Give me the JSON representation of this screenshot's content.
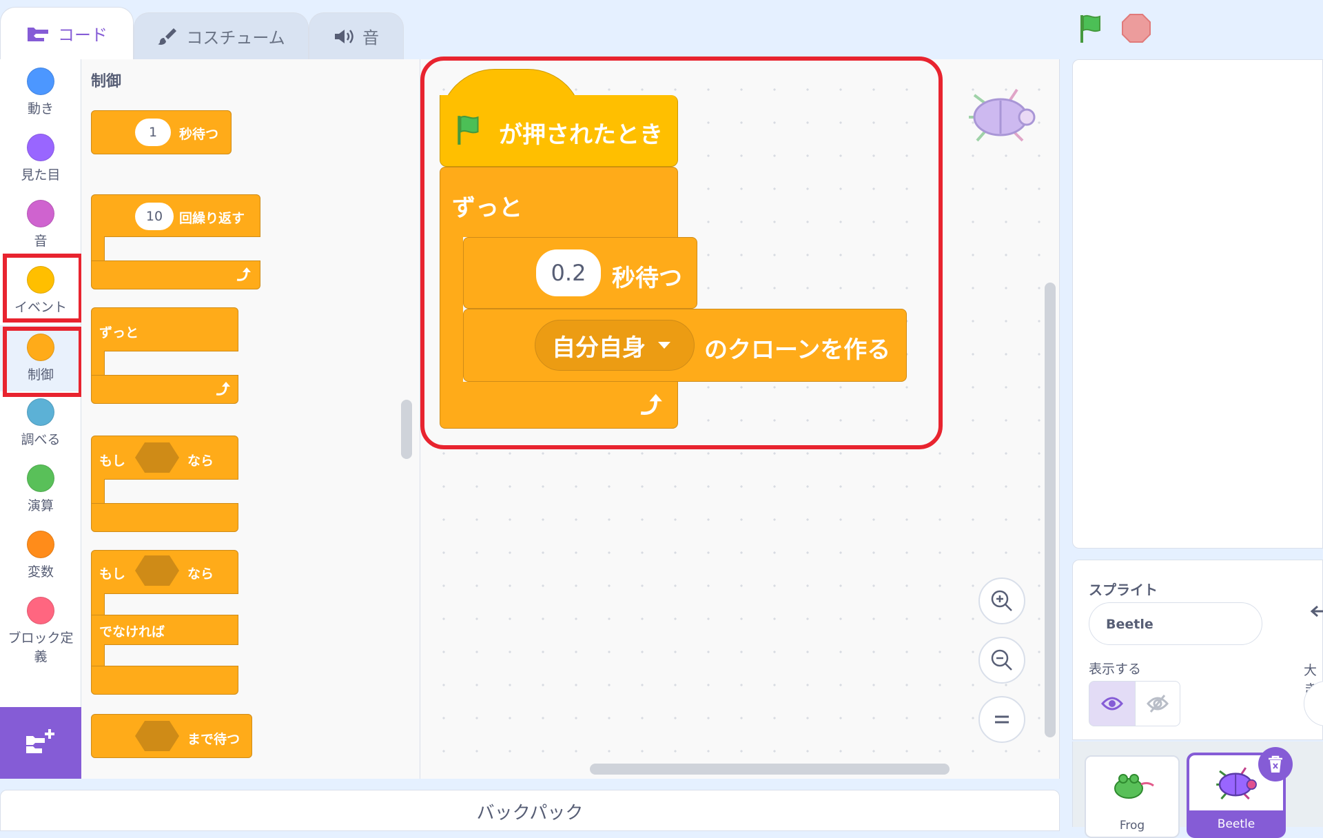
{
  "tabs": [
    {
      "label": "コード",
      "icon": "code-icon"
    },
    {
      "label": "コスチューム",
      "icon": "brush-icon"
    },
    {
      "label": "音",
      "icon": "speaker-icon"
    }
  ],
  "controls": {
    "green_flag": "green-flag-icon",
    "stop": "stop-icon"
  },
  "categories": [
    {
      "label": "動き",
      "color": "#4c97ff"
    },
    {
      "label": "見た目",
      "color": "#9966ff"
    },
    {
      "label": "音",
      "color": "#cf63cf"
    },
    {
      "label": "イベント",
      "color": "#ffbf00"
    },
    {
      "label": "制御",
      "color": "#ffab19"
    },
    {
      "label": "調べる",
      "color": "#5cb1d6"
    },
    {
      "label": "演算",
      "color": "#59c059"
    },
    {
      "label": "変数",
      "color": "#ff8c1a"
    },
    {
      "label": "ブロック定",
      "label2": "義",
      "color": "#ff6680"
    }
  ],
  "palette": {
    "title": "制御",
    "wait": {
      "value": "1",
      "label": "秒待つ"
    },
    "repeat": {
      "value": "10",
      "label": "回繰り返す"
    },
    "forever": {
      "label": "ずっと"
    },
    "if_then": {
      "if": "もし",
      "then": "なら"
    },
    "if_else": {
      "if": "もし",
      "then": "なら",
      "else": "でなければ"
    },
    "wait_until": {
      "label": "まで待つ"
    }
  },
  "script": {
    "hat": "が押されたとき",
    "forever": "ずっと",
    "wait_value": "0.2",
    "wait_label": "秒待つ",
    "clone_target": "自分自身",
    "clone_label": "のクローンを作る"
  },
  "sprite_panel": {
    "title": "スプライト",
    "name": "Beetle",
    "show_label": "表示する",
    "size_label": "大き"
  },
  "sprites": [
    {
      "name": "Frog"
    },
    {
      "name": "Beetle"
    }
  ],
  "backpack": "バックパック",
  "colors": {
    "control": "#ffab19",
    "events": "#ffbf00",
    "highlight": "#e8242f",
    "accent": "#855cd6"
  }
}
